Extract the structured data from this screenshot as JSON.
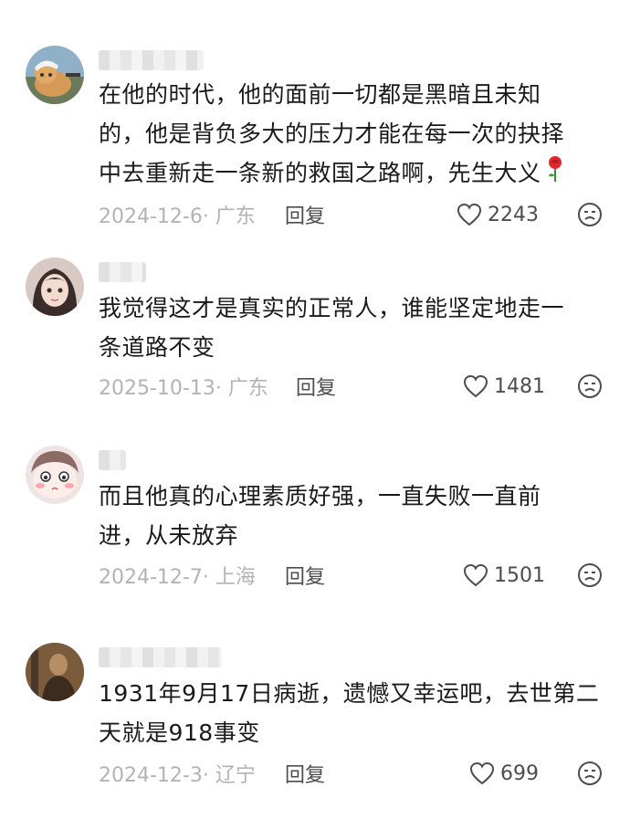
{
  "comments": [
    {
      "text_lines": [
        "在他的时代，他的面前一切都是黑暗且未知",
        "的，他是背负多大的压力才能在每一次的抉择",
        "中去重新走一条新的救国之路啊，先生大义"
      ],
      "date": "2024-12-6",
      "location": "广东",
      "reply_label": "回复",
      "likes": "2243",
      "avatar": "cat-cyclist-avatar",
      "emoji": "rose-icon"
    },
    {
      "text_lines": [
        "我觉得这才是真实的正常人，谁能坚定地走一",
        "条道路不变"
      ],
      "date": "2025-10-13",
      "location": "广东",
      "reply_label": "回复",
      "likes": "1481",
      "avatar": "anime-girl-avatar"
    },
    {
      "text_lines": [
        "而且他真的心理素质好强，一直失败一直前",
        "进，从未放弃"
      ],
      "date": "2024-12-7",
      "location": "上海",
      "reply_label": "回复",
      "likes": "1501",
      "avatar": "cartoon-face-avatar"
    },
    {
      "text_lines": [
        "1931年9月17日病逝，遗憾又幸运吧，去世第二",
        "天就是918事变"
      ],
      "date": "2024-12-3",
      "location": "辽宁",
      "reply_label": "回复",
      "likes": "699",
      "avatar": "vintage-photo-avatar"
    }
  ],
  "colors": {
    "text": "#1a1a1a",
    "meta": "#b3b3b3",
    "action": "#4d4d4d",
    "rose": "#e0282e"
  }
}
